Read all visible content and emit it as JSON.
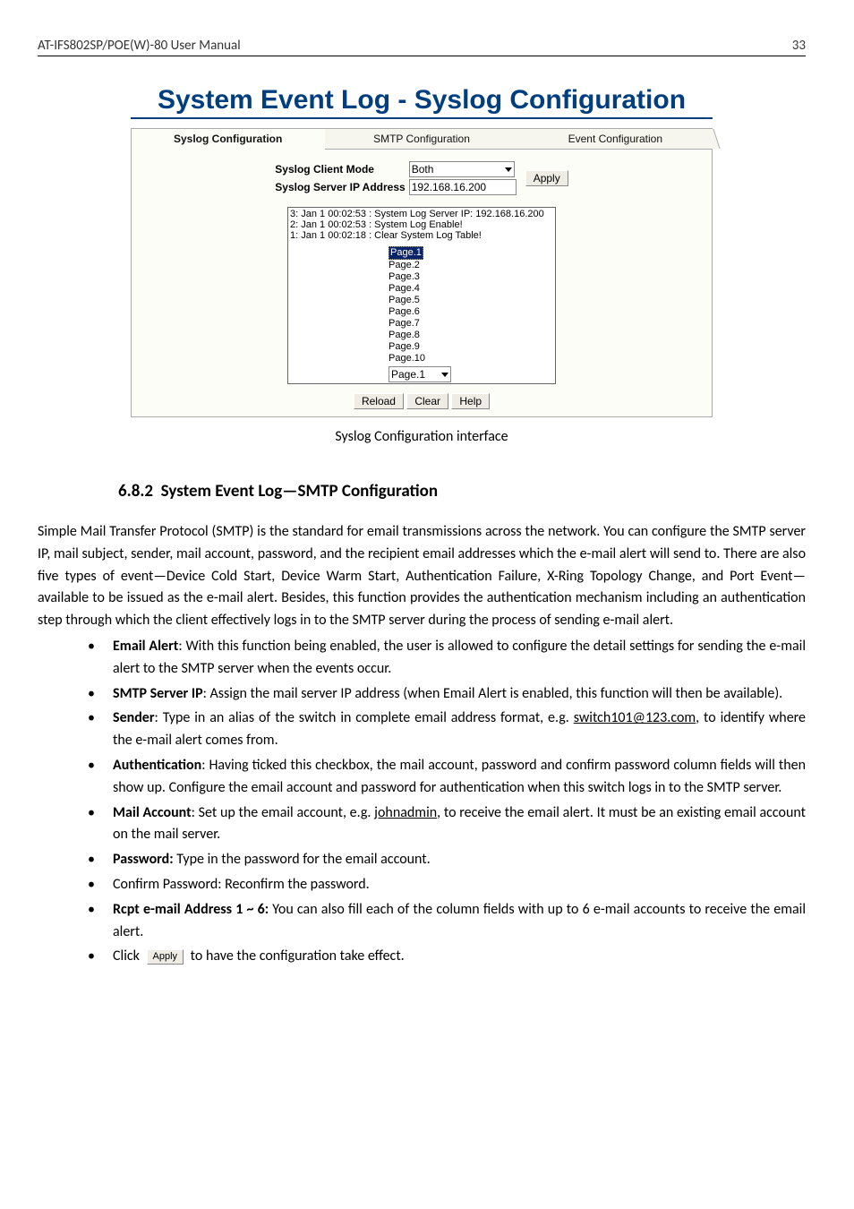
{
  "header": {
    "title": "AT-IFS802SP/POE(W)-80 User Manual",
    "page_number": "33"
  },
  "ui": {
    "heading": "System Event Log - Syslog Configuration",
    "tabs": [
      {
        "label": "Syslog Configuration",
        "active": true
      },
      {
        "label": "SMTP Configuration",
        "active": false
      },
      {
        "label": "Event Configuration",
        "active": false
      }
    ],
    "form": {
      "client_mode_label": "Syslog Client Mode",
      "client_mode_value": "Both",
      "server_ip_label": "Syslog Server IP Address",
      "server_ip_value": "192.168.16.200",
      "apply_label": "Apply"
    },
    "log_entries": [
      "3: Jan 1 00:02:53 : System Log Server IP: 192.168.16.200",
      "2: Jan 1 00:02:53 : System Log Enable!",
      "1: Jan 1 00:02:18 : Clear System Log Table!"
    ],
    "page_list": [
      "Page.1",
      "Page.2",
      "Page.3",
      "Page.4",
      "Page.5",
      "Page.6",
      "Page.7",
      "Page.8",
      "Page.9",
      "Page.10"
    ],
    "page_selected_index": 0,
    "page_dropdown_value": "Page.1",
    "buttons": {
      "reload": "Reload",
      "clear": "Clear",
      "help": "Help"
    },
    "caption": "Syslog Configuration interface"
  },
  "section": {
    "number": "6.8.2",
    "title": "System Event Log—SMTP Configuration",
    "intro": "Simple Mail Transfer Protocol (SMTP) is the standard for email transmissions across the network. You can configure the SMTP server IP, mail subject, sender, mail account, password, and the recipient email addresses which the e-mail alert will send to. There are also five types of event—Device Cold Start, Device Warm Start, Authentication Failure, X-Ring Topology Change, and Port Event—available to be issued as the e-mail alert. Besides, this function provides the authentication mechanism including an authentication step through which the client effectively logs in to the SMTP server during the process of sending e-mail alert.",
    "bullets": {
      "email_alert_label": "Email Alert",
      "email_alert_text": ": With this function being enabled, the user is allowed to configure the detail settings for sending the e-mail alert to the SMTP server when the events occur.",
      "smtp_ip_label": "SMTP Server IP",
      "smtp_ip_text": ": Assign the mail server IP address (when Email Alert is enabled, this function will then be available).",
      "sender_label": "Sender",
      "sender_text_pre": ": Type in an alias of the switch in complete email address format, e.g. ",
      "sender_link": "switch101@123.com",
      "sender_text_post": ", to identify where the e-mail alert comes from.",
      "auth_label": "Authentication",
      "auth_text": ": Having ticked this checkbox, the mail account, password and confirm password column fields will then show up. Configure the email account and password for authentication when this switch logs in to the SMTP server.",
      "mail_acct_label": "Mail Account",
      "mail_acct_text_pre": ": Set up the email account, e.g. ",
      "mail_acct_link": "johnadmin",
      "mail_acct_text_post": ", to receive the email alert. It must be an existing email account on the mail server.",
      "password_label": "Password:",
      "password_text": " Type in the password for the email account.",
      "confirm_text": "Confirm Password: Reconfirm the password.",
      "rcpt_label": "Rcpt e-mail Address 1 ~ 6:",
      "rcpt_text": " You can also fill each of the column fields with up to 6 e-mail accounts to receive the email alert.",
      "click_pre": "Click ",
      "click_btn": "Apply",
      "click_post": " to have the configuration take effect."
    }
  }
}
